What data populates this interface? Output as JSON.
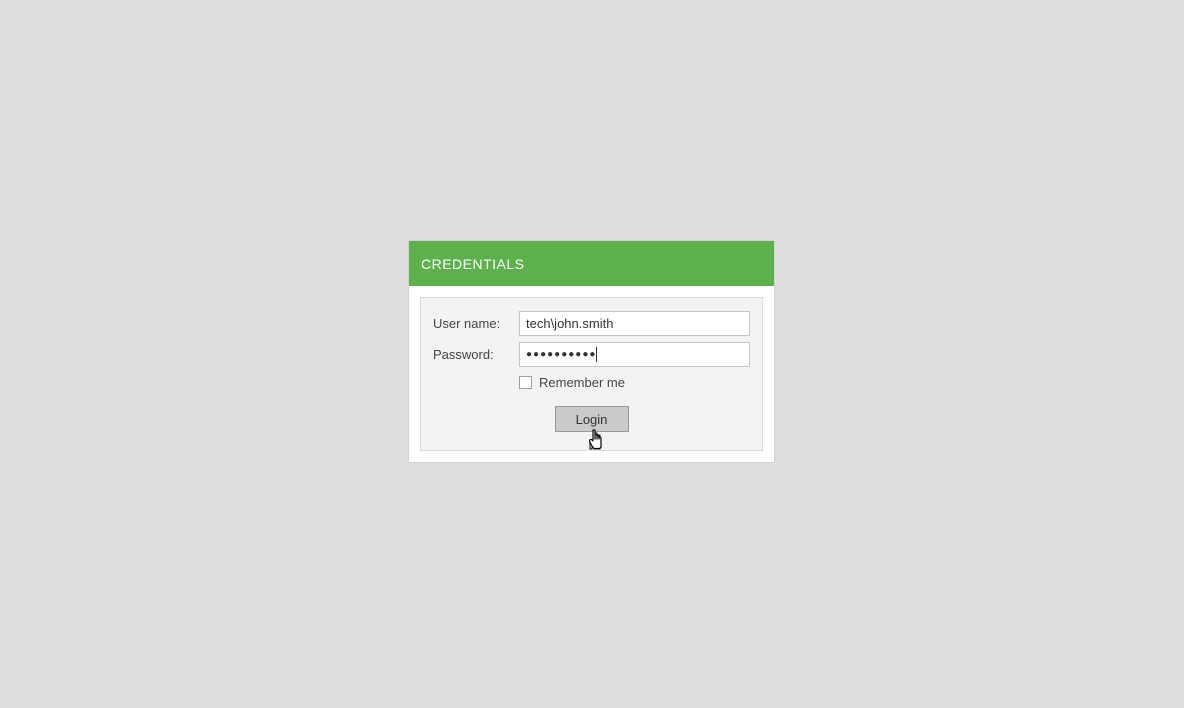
{
  "panel": {
    "title": "CREDENTIALS"
  },
  "form": {
    "username_label": "User name:",
    "username_value": "tech\\john.smith",
    "password_label": "Password:",
    "password_masked": "●●●●●●●●●●",
    "remember_label": "Remember me",
    "remember_checked": false,
    "login_button": "Login"
  }
}
